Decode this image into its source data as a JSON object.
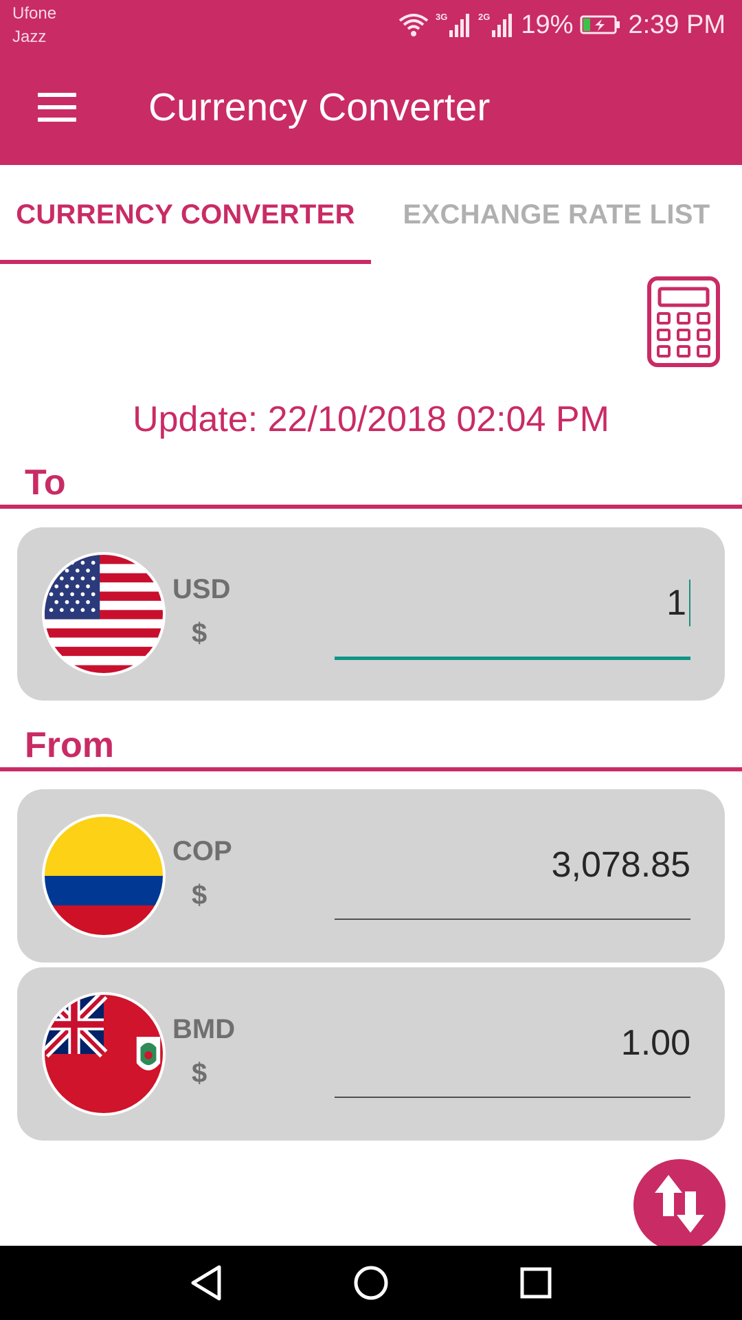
{
  "status_bar": {
    "carrier_1": "Ufone",
    "carrier_2": "Jazz",
    "network_1": "3G",
    "network_2": "2G",
    "battery_percent": "19%",
    "time": "2:39 PM"
  },
  "app_bar": {
    "title": "Currency Converter",
    "menu_icon": "hamburger-menu-icon"
  },
  "tabs": [
    {
      "label": "CURRENCY CONVERTER",
      "selected": true
    },
    {
      "label": "EXCHANGE RATE LIST",
      "selected": false
    }
  ],
  "calculator_icon": "calculator-icon",
  "update_text": "Update: 22/10/2018 02:04 PM",
  "to_section": {
    "label": "To",
    "currency": {
      "code": "USD",
      "symbol": "$",
      "amount": "1",
      "flag": "us-flag-icon"
    }
  },
  "from_section": {
    "label": "From",
    "currencies": [
      {
        "code": "COP",
        "symbol": "$",
        "amount": "3,078.85",
        "flag": "colombia-flag-icon"
      },
      {
        "code": "BMD",
        "symbol": "$",
        "amount": "1.00",
        "flag": "bermuda-flag-icon"
      }
    ]
  },
  "fab_icon": "swap-arrows-icon",
  "nav_bar": {
    "back": "back-triangle-icon",
    "home": "home-circle-icon",
    "recents": "recents-square-icon"
  },
  "colors": {
    "primary": "#c92b65",
    "tab_inactive": "#b0b0b0",
    "card_bg": "#d3d3d3",
    "focus_underline": "#0d9488"
  }
}
